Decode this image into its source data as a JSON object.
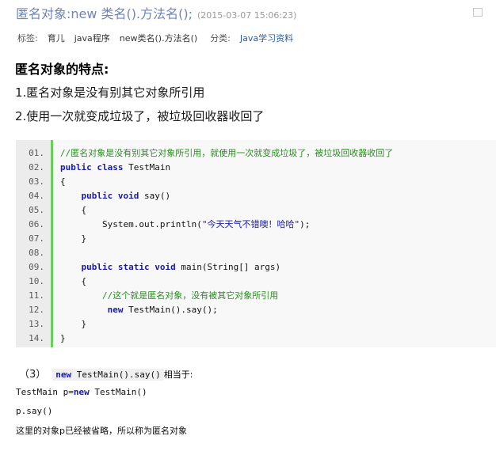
{
  "header": {
    "title": "匿名对象:new 类名().方法名();",
    "date": "(2015-03-07 15:06:23)"
  },
  "meta": {
    "tags_label": "标签:",
    "tags": [
      "育儿",
      "java程序",
      "new类名().方法名()"
    ],
    "category_label": "分类:",
    "category": "Java学习资料"
  },
  "intro": {
    "heading": "匿名对象的特点:",
    "points": [
      "1.匿名对象是没有别其它对象所引用",
      "2.使用一次就变成垃圾了，被垃圾回收器收回了"
    ]
  },
  "code": {
    "line_numbers": [
      "01.",
      "02.",
      "03.",
      "04.",
      "05.",
      "06.",
      "07.",
      "08.",
      "09.",
      "10.",
      "11.",
      "12.",
      "13.",
      "14."
    ],
    "lines": [
      {
        "indent": "",
        "parts": [
          {
            "t": "cm",
            "v": "//匿名对象是没有别其它对象所引用，就使用一次就变成垃圾了，被垃圾回收器收回了"
          }
        ]
      },
      {
        "indent": "",
        "parts": [
          {
            "t": "kw",
            "v": "public class"
          },
          {
            "t": "tx",
            "v": " TestMain"
          }
        ]
      },
      {
        "indent": "",
        "parts": [
          {
            "t": "tx",
            "v": "{"
          }
        ]
      },
      {
        "indent": "    ",
        "parts": [
          {
            "t": "kw",
            "v": "public void"
          },
          {
            "t": "tx",
            "v": " say()"
          }
        ]
      },
      {
        "indent": "    ",
        "parts": [
          {
            "t": "tx",
            "v": "{"
          }
        ]
      },
      {
        "indent": "        ",
        "parts": [
          {
            "t": "tx",
            "v": "System.out.println("
          },
          {
            "t": "str",
            "v": "\"今天天气不错噢！哈哈\""
          },
          {
            "t": "tx",
            "v": ");"
          }
        ]
      },
      {
        "indent": "    ",
        "parts": [
          {
            "t": "tx",
            "v": "}"
          }
        ]
      },
      {
        "indent": "",
        "parts": []
      },
      {
        "indent": "    ",
        "parts": [
          {
            "t": "kw",
            "v": "public static void"
          },
          {
            "t": "tx",
            "v": " main(String[] args)"
          }
        ]
      },
      {
        "indent": "    ",
        "parts": [
          {
            "t": "tx",
            "v": "{"
          }
        ]
      },
      {
        "indent": "        ",
        "parts": [
          {
            "t": "cm",
            "v": "//这个就是匿名对象，没有被其它对象所引用"
          }
        ]
      },
      {
        "indent": "         ",
        "parts": [
          {
            "t": "kw",
            "v": "new"
          },
          {
            "t": "tx",
            "v": " TestMain().say();"
          }
        ]
      },
      {
        "indent": "    ",
        "parts": [
          {
            "t": "tx",
            "v": "}"
          }
        ]
      },
      {
        "indent": "",
        "parts": [
          {
            "t": "tx",
            "v": "}"
          }
        ]
      }
    ]
  },
  "bottom": {
    "number": "（3）",
    "inline_kw": "new",
    "inline_rest": " TestMain().say()",
    "inline_tail": "相当于:",
    "line1_a": "TestMain p=",
    "line1_kw": "new",
    "line1_b": " TestMain()",
    "line2": "p.say()",
    "line3": "这里的对象p已经被省略，所以称为匿名对象"
  }
}
